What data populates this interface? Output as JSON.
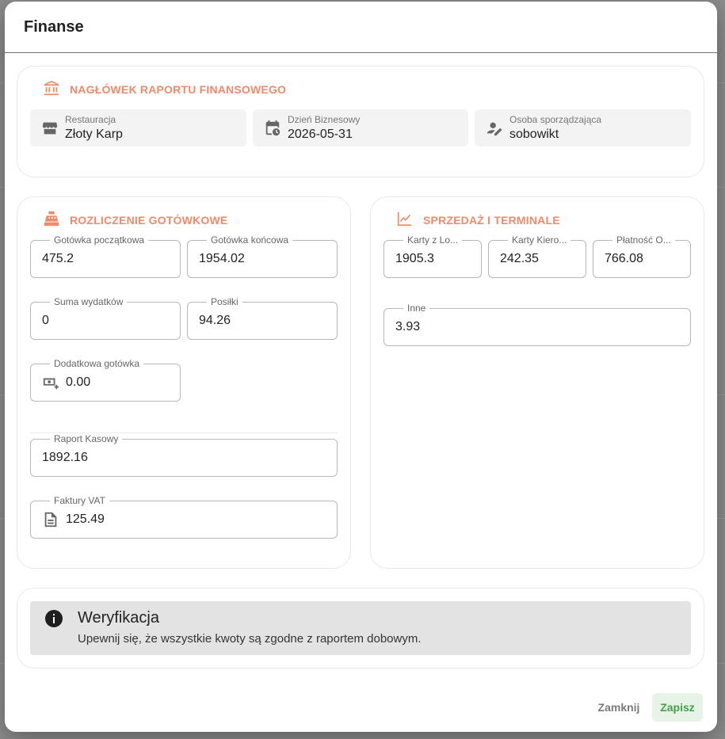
{
  "dialog": {
    "title": "Finanse"
  },
  "header_card": {
    "title": "NAGŁÓWEK RAPORTU FINANSOWEGO",
    "icon": "bank-icon",
    "fields": [
      {
        "label": "Restauracja",
        "value": "Złoty Karp",
        "icon": "store-icon"
      },
      {
        "label": "Dzień Biznesowy",
        "value": "2026-05-31",
        "icon": "calendar-clock-icon"
      },
      {
        "label": "Osoba sporządzająca",
        "value": "sobowikt",
        "icon": "person-edit-icon"
      }
    ]
  },
  "cash_card": {
    "title": "ROZLICZENIE GOTÓWKOWE",
    "icon": "cash-register-icon",
    "opening_cash": {
      "label": "Gotówka początkowa",
      "value": "475.2"
    },
    "closing_cash": {
      "label": "Gotówka końcowa",
      "value": "1954.02"
    },
    "expenses_sum": {
      "label": "Suma wydatków",
      "value": "0"
    },
    "meals": {
      "label": "Posiłki",
      "value": "94.26"
    },
    "extra_cash": {
      "label": "Dodatkowa gotówka",
      "value": "0.00",
      "icon": "cash-plus-icon"
    },
    "cash_report": {
      "label": "Raport Kasowy",
      "value": "1892.16"
    },
    "vat_invoices": {
      "label": "Faktury VAT",
      "value": "125.49",
      "icon": "document-icon"
    }
  },
  "sales_card": {
    "title": "SPRZEDAŻ I TERMINALE",
    "icon": "chart-line-icon",
    "card_lo": {
      "label": "Karty z Lo...",
      "value": "1905.3"
    },
    "card_kiero": {
      "label": "Karty Kiero...",
      "value": "242.35"
    },
    "payment_o": {
      "label": "Płatność O...",
      "value": "766.08"
    },
    "other": {
      "label": "Inne",
      "value": "3.93"
    }
  },
  "verification": {
    "icon": "info-icon",
    "title": "Weryfikacja",
    "text": "Upewnij się, że wszystkie kwoty są zgodne z raportem dobowym."
  },
  "actions": {
    "close_label": "Zamknij",
    "save_label": "Zapisz"
  },
  "colors": {
    "accent": "#f08a6b",
    "save_text": "#43a047",
    "save_bg": "#e6f3e6"
  }
}
